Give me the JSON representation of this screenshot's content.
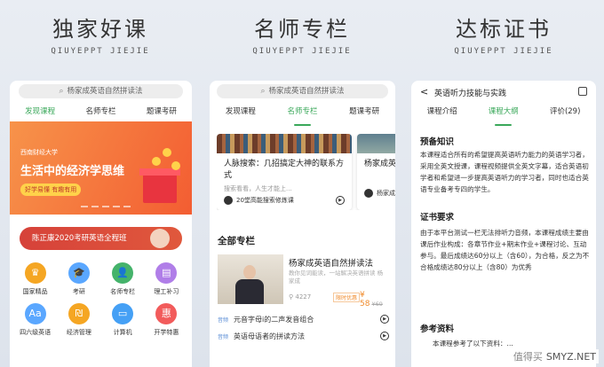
{
  "panels": [
    {
      "title": "独家好课",
      "subtitle": "QIUYEPPT JIEJIE"
    },
    {
      "title": "名师专栏",
      "subtitle": "QIUYEPPT JIEJIE"
    },
    {
      "title": "达标证书",
      "subtitle": "QIUYEPPT JIEJIE"
    }
  ],
  "search": {
    "placeholder": "杨家成英语自然拼读法"
  },
  "screen1": {
    "tabs": [
      "发现课程",
      "名师专栏",
      "题课考研"
    ],
    "banner": {
      "school": "西南财经大学",
      "title": "生活中的经济学思维",
      "pill": "好学易懂 有趣有用"
    },
    "ad": "陈正康2020考研英语全程班",
    "grid": [
      {
        "label": "国家精品",
        "icon": "crown-icon"
      },
      {
        "label": "考研",
        "icon": "graduation-cap-icon"
      },
      {
        "label": "名师专栏",
        "icon": "teacher-icon"
      },
      {
        "label": "理工补习",
        "icon": "book-icon"
      },
      {
        "label": "四六级英语",
        "icon": "aa-icon"
      },
      {
        "label": "经济管理",
        "icon": "chart-icon"
      },
      {
        "label": "计算机",
        "icon": "monitor-icon"
      },
      {
        "label": "开学特惠",
        "icon": "sale-badge-icon"
      }
    ],
    "grid_glyphs": [
      "♛",
      "🎓",
      "👤",
      "▤",
      "Aa",
      "₪",
      "▭",
      "惠"
    ],
    "grid_colors": [
      "#f5a623",
      "#5aa7ff",
      "#45b36b",
      "#b07ee8",
      "#5aa7ff",
      "#f5a623",
      "#45a0f5",
      "#f25b5b"
    ]
  },
  "screen2": {
    "tabs": [
      "发现课程",
      "名师专栏",
      "题课考研"
    ],
    "card1": {
      "title": "人脉搜索：几招搞定大神的联系方式",
      "sub": "搜索看看，人生才能上...",
      "author": "20堂高能搜索修炼课"
    },
    "card2": {
      "title": "杨家成英",
      "author": "杨家成"
    },
    "section": "全部专栏",
    "course": {
      "name": "杨家成英语自然拼读法",
      "desc": "教你见词能读，一站解决英语拼读 杨家成",
      "count": "4227",
      "tag": "限时优惠",
      "price": "¥ 58",
      "orig": "¥69"
    },
    "lessons": [
      {
        "badge": "音频",
        "title": "元音字母i的二声发音组合"
      },
      {
        "badge": "音频",
        "title": "英语母语者的拼读方法"
      }
    ]
  },
  "screen3": {
    "back": "<",
    "title": "英语听力技能与实践",
    "tabs": [
      "课程介绍",
      "课程大纲",
      "评价(29)"
    ],
    "h1": "预备知识",
    "p1": "本课程适合所有的希望提高英语听力能力的英语学习者，采用全英文授课，课程视频提供全英文字幕，适合英语初学者和希望进一步提高英语听力的学习者，同时也适合英语专业备考专四的学生。",
    "h2": "证书要求",
    "p2": "由于本平台测试一栏无法排听力音频，本课程成绩主要由课后作业构成：各章节作业+期末作业+课程讨论、互动参与。最后成绩达60分以上（含60），为合格，反之为不合格成绩达80分以上（含80）为优秀",
    "h3": "参考资料",
    "p3": "本课程参考了以下资料：..."
  },
  "watermark": {
    "text": "SMYZ.NET",
    "tag": "值得买"
  }
}
